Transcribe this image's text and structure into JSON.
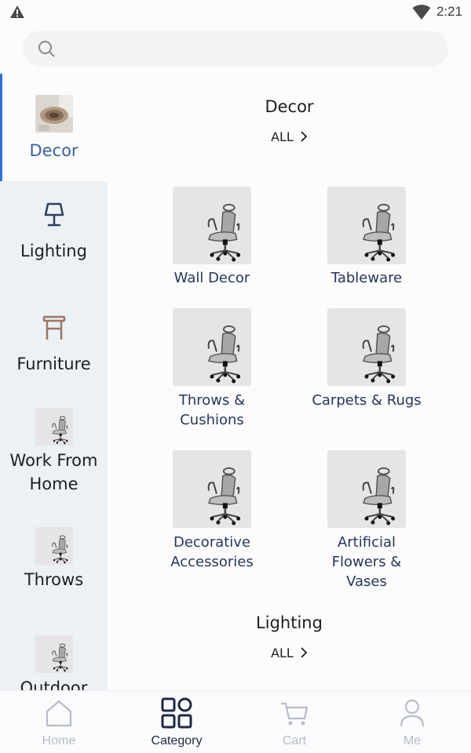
{
  "status_bar": {
    "time": "2:21"
  },
  "search": {
    "placeholder": ""
  },
  "sidebar": {
    "items": [
      {
        "label": "Decor",
        "icon": "decor-thumbnail",
        "active": true
      },
      {
        "label": "Lighting",
        "icon": "lamp-icon"
      },
      {
        "label": "Furniture",
        "icon": "stool-icon"
      },
      {
        "label": "Work From Home",
        "line1": "Work From",
        "line2": "Home",
        "icon": "office-chair-thumbnail"
      },
      {
        "label": "Throws",
        "icon": "office-chair-thumbnail"
      },
      {
        "label": "Outdoor",
        "icon": "office-chair-thumbnail"
      }
    ]
  },
  "main": {
    "sections": [
      {
        "title": "Decor",
        "all_label": "ALL",
        "tiles": [
          {
            "label": "Wall Decor"
          },
          {
            "label": "Tableware"
          },
          {
            "label": "Throws & Cushions",
            "line1": "Throws &",
            "line2": "Cushions"
          },
          {
            "label": "Carpets & Rugs"
          },
          {
            "label": "Decorative Accessories",
            "line1": "Decorative",
            "line2": "Accessories"
          },
          {
            "label": "Artificial Flowers & Vases",
            "line1": "Artificial",
            "line2": "Flowers &",
            "line3": "Vases"
          }
        ]
      },
      {
        "title": "Lighting",
        "all_label": "ALL"
      }
    ]
  },
  "bottom_nav": {
    "items": [
      {
        "label": "Home",
        "icon": "home-icon"
      },
      {
        "label": "Category",
        "icon": "grid-icon",
        "active": true
      },
      {
        "label": "Cart",
        "icon": "cart-icon"
      },
      {
        "label": "Me",
        "icon": "person-icon"
      }
    ]
  },
  "colors": {
    "accent": "#2f6fd1",
    "sidebar_bg": "#ebf1f5",
    "tile_label": "#25375a",
    "nav_active": "#1e2a44",
    "nav_inactive": "#b6bcc8"
  }
}
